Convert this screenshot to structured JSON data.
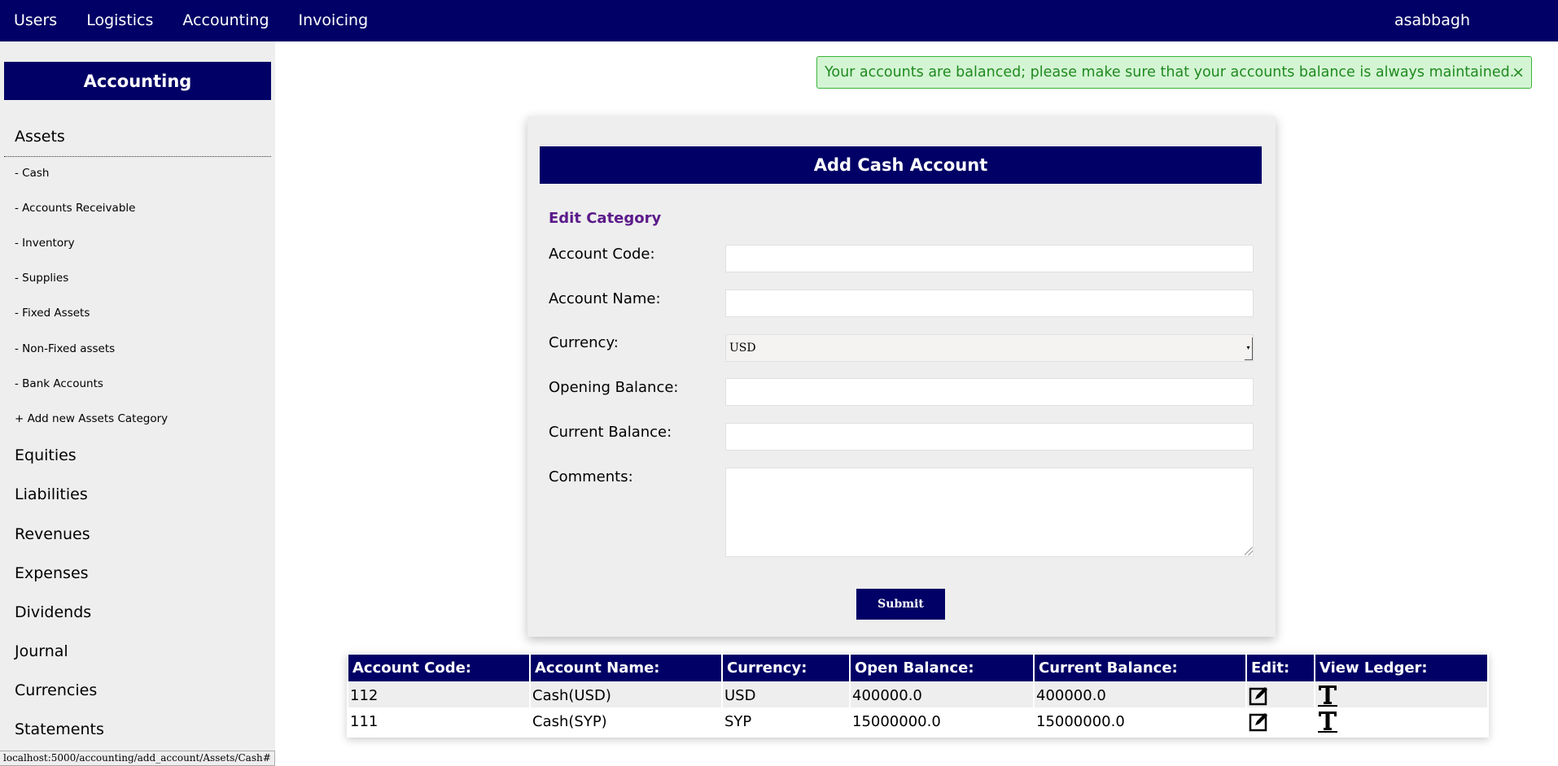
{
  "nav": {
    "items": [
      "Users",
      "Logistics",
      "Accounting",
      "Invoicing"
    ],
    "user": "asabbagh"
  },
  "sidebar": {
    "header": "Accounting",
    "assets_title": "Assets",
    "asset_items": [
      "- Cash",
      "- Accounts Receivable",
      "- Inventory",
      "- Supplies",
      "- Fixed Assets",
      "- Non-Fixed assets",
      "- Bank Accounts",
      "+ Add new Assets Category"
    ],
    "sections": [
      "Equities",
      "Liabilities",
      "Revenues",
      "Expenses",
      "Dividends",
      "Journal",
      "Currencies",
      "Statements"
    ]
  },
  "alert": {
    "message": "Your accounts are balanced; please make sure that your accounts balance is always maintained.",
    "close": "×"
  },
  "form": {
    "title": "Add Cash Account",
    "subtitle": "Edit Category",
    "labels": {
      "account_code": "Account Code:",
      "account_name": "Account Name:",
      "currency": "Currency:",
      "opening_balance": "Opening Balance:",
      "current_balance": "Current Balance:",
      "comments": "Comments:"
    },
    "values": {
      "account_code": "",
      "account_name": "",
      "currency": "USD",
      "opening_balance": "",
      "current_balance": "",
      "comments": ""
    },
    "submit": "Submit"
  },
  "table": {
    "headers": [
      "Account Code:",
      "Account Name:",
      "Currency:",
      "Open Balance:",
      "Current Balance:",
      "Edit:",
      "View Ledger:"
    ],
    "rows": [
      [
        "112",
        "Cash(USD)",
        "USD",
        "400000.0",
        "400000.0"
      ],
      [
        "111",
        "Cash(SYP)",
        "SYP",
        "15000000.0",
        "15000000.0"
      ]
    ],
    "icons": {
      "edit": "edit-icon",
      "ledger": "text-ledger-icon"
    }
  },
  "statusbar": {
    "url": "localhost:5000/accounting/add_account/Assets/Cash#"
  },
  "colors": {
    "navy": "#000066",
    "sidebar_bg": "#eeeeee",
    "alert_bg": "#d4f5d4",
    "alert_text": "#1f8a1f",
    "subtitle": "#5b1a8a"
  }
}
